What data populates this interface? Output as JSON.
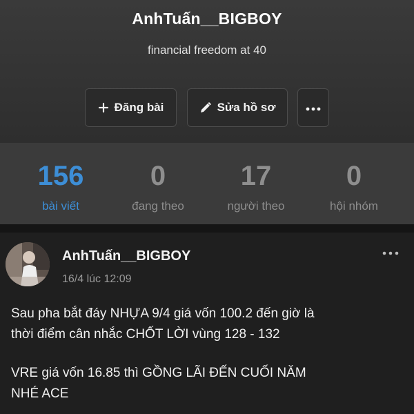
{
  "profile": {
    "username": "AnhTuấn__BIGBOY",
    "bio": "financial freedom at 40"
  },
  "actions": {
    "post_label": "Đăng bài",
    "edit_label": "Sửa hồ sơ",
    "post_icon": "plus-icon",
    "edit_icon": "pencil-icon",
    "more_icon": "more-icon"
  },
  "stats": [
    {
      "value": "156",
      "label": "bài viết",
      "active": true
    },
    {
      "value": "0",
      "label": "đang theo",
      "active": false
    },
    {
      "value": "17",
      "label": "người theo",
      "active": false
    },
    {
      "value": "0",
      "label": "hội nhóm",
      "active": false
    }
  ],
  "post": {
    "author": "AnhTuấn__BIGBOY",
    "time": "16/4 lúc 12:09",
    "lines": [
      "Sau pha bắt đáy NHỰA 9/4 giá vốn 100.2 đến giờ là",
      "thời điểm cân nhắc CHỐT LỜI vùng 128 - 132",
      "VRE giá vốn 16.85 thì GỒNG LÃI ĐẾN CUỐI NĂM",
      "NHÉ ACE"
    ]
  },
  "colors": {
    "accent": "#3d8ed6",
    "background": "#1e1e1e",
    "stats_bg": "#3b3b3b"
  }
}
